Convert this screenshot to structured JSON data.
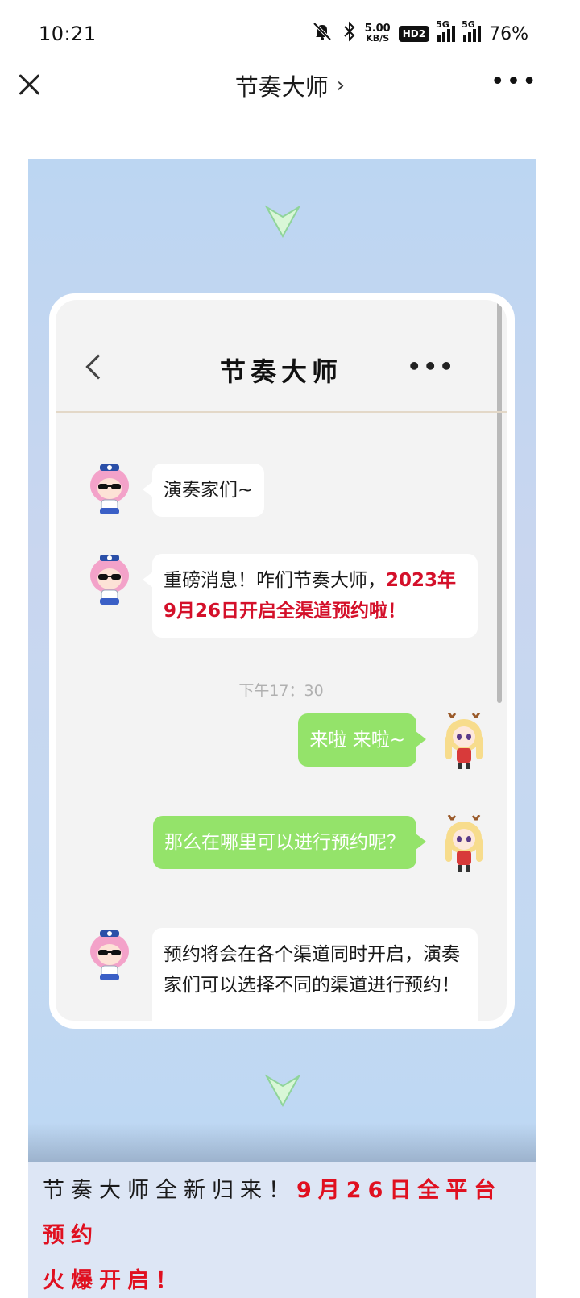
{
  "status_bar": {
    "time": "10:21",
    "net_speed_value": "5.00",
    "net_speed_unit": "KB/S",
    "hd_label": "HD2",
    "sim1_label": "5G",
    "sim2_label": "5G",
    "battery": "76%",
    "icons": [
      "mute-bell-icon",
      "bluetooth-icon",
      "signal-icon",
      "signal-icon"
    ]
  },
  "title_bar": {
    "title": "节奏大师",
    "chevron": "›",
    "more": "•••"
  },
  "chat": {
    "title": "节奏大师",
    "more": "•••",
    "messages": [
      {
        "side": "left",
        "text": "演奏家们~"
      },
      {
        "side": "left",
        "text_plain": "重磅消息！咋们节奏大师，",
        "text_highlight": "2023年9月26日开启全渠道预约啦！"
      },
      {
        "side": "right",
        "text": "来啦 来啦~"
      },
      {
        "side": "right",
        "text": "那么在哪里可以进行预约呢？"
      },
      {
        "side": "left",
        "text": "预约将会在各个渠道同时开启，演奏家们可以选择不同的渠道进行预约！"
      }
    ],
    "timestamp": "下午17：30"
  },
  "caption": {
    "plain": "节奏大师全新归来！",
    "highlight_1": "9月26日全平台预约",
    "highlight_2": "火爆开启！"
  },
  "colors": {
    "accent_red": "#d4102a",
    "bubble_green": "#94e36a",
    "poster_blue": "#bcd6f2"
  }
}
